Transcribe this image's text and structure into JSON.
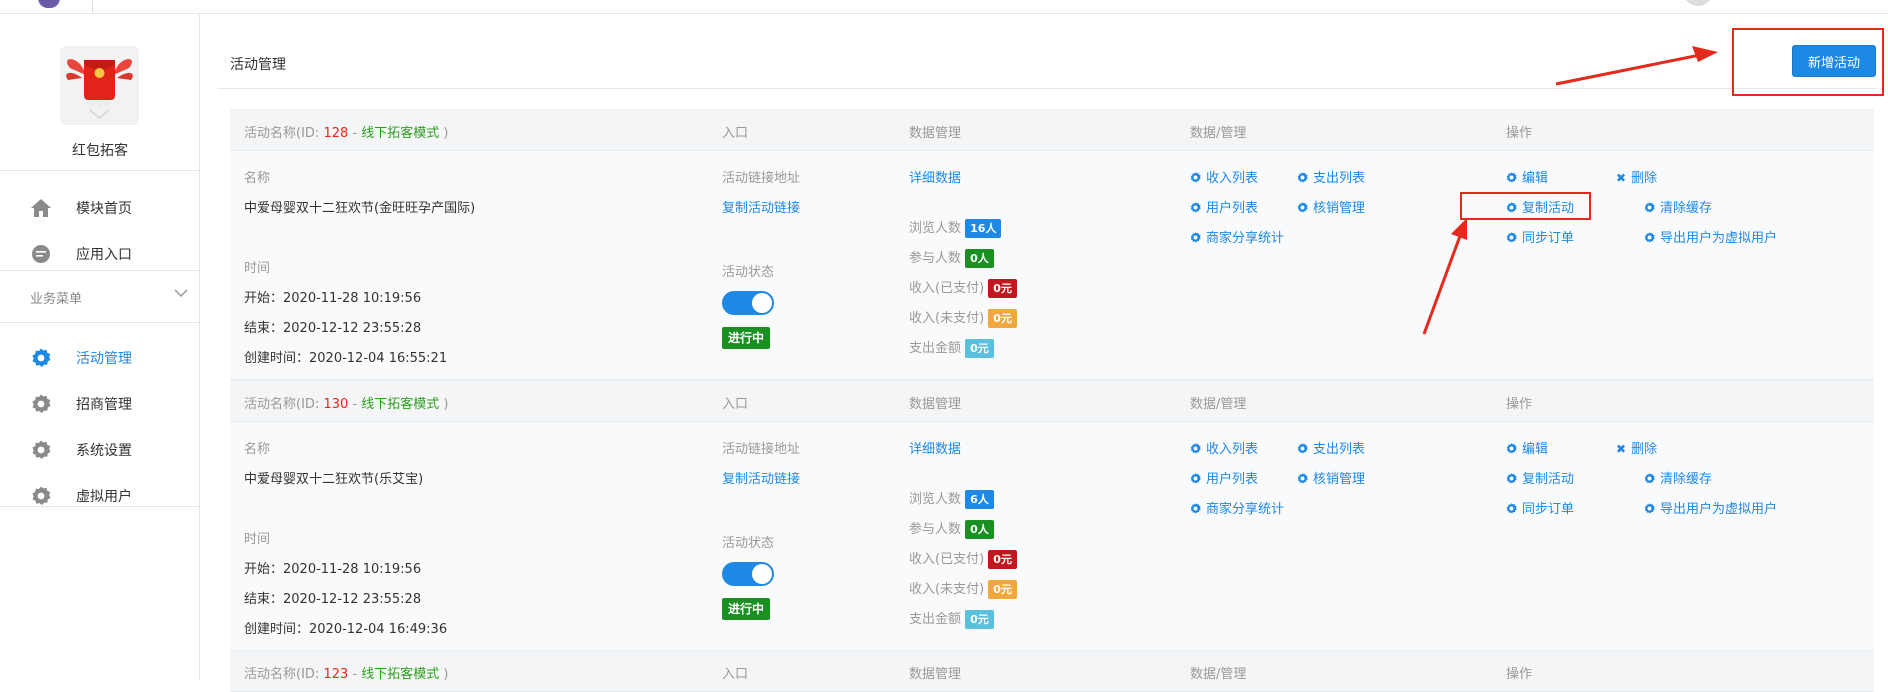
{
  "app": {
    "name": "红包拓客"
  },
  "nav": {
    "items": [
      {
        "label": "模块首页"
      },
      {
        "label": "应用入口"
      }
    ],
    "section_label": "业务菜单",
    "sub_items": [
      {
        "label": "活动管理",
        "active": true
      },
      {
        "label": "招商管理"
      },
      {
        "label": "系统设置"
      },
      {
        "label": "虚拟用户"
      }
    ]
  },
  "page": {
    "title": "活动管理",
    "add_button": "新增活动"
  },
  "columns": {
    "name_prefix": "活动名称(ID: ",
    "name_mode": "线下拓客模式",
    "entry": "入口",
    "data_mgmt": "数据管理",
    "data_ops": "数据/管理",
    "ops": "操作"
  },
  "labels": {
    "name": "名称",
    "time": "时间",
    "start": "开始：",
    "end": "结束：",
    "created": "创建时间：",
    "link_addr": "活动链接地址",
    "copy_link": "复制活动链接",
    "status_label": "活动状态",
    "detail": "详细数据",
    "views": "浏览人数",
    "participants": "参与人数",
    "income_paid": "收入(已支付)",
    "income_unpaid": "收入(未支付)",
    "expense": "支出金额",
    "income_list": "收入列表",
    "expense_list": "支出列表",
    "user_list": "用户列表",
    "verify": "核销管理",
    "merchant_share": "商家分享统计",
    "edit": "编辑",
    "delete": "删除",
    "copy_activity": "复制活动",
    "clear_cache": "清除缓存",
    "sync_order": "同步订单",
    "export_virtual": "导出用户为虚拟用户"
  },
  "activities": [
    {
      "id": "128",
      "name": "中爱母婴双十二狂欢节(金旺旺孕产国际)",
      "start": "2020-11-28 10:19:56",
      "end": "2020-12-12 23:55:28",
      "created": "2020-12-04 16:55:21",
      "status": "进行中",
      "views": "16人",
      "participants": "0人",
      "income_paid": "0元",
      "income_unpaid": "0元",
      "expense": "0元"
    },
    {
      "id": "130",
      "name": "中爱母婴双十二狂欢节(乐艾宝)",
      "start": "2020-11-28 10:19:56",
      "end": "2020-12-12 23:55:28",
      "created": "2020-12-04 16:49:36",
      "status": "进行中",
      "views": "6人",
      "participants": "0人",
      "income_paid": "0元",
      "income_unpaid": "0元",
      "expense": "0元"
    },
    {
      "id": "123"
    }
  ],
  "colors": {
    "accent": "#1e88e5",
    "annotation": "#e5291d",
    "status_green": "#1a8f22"
  }
}
